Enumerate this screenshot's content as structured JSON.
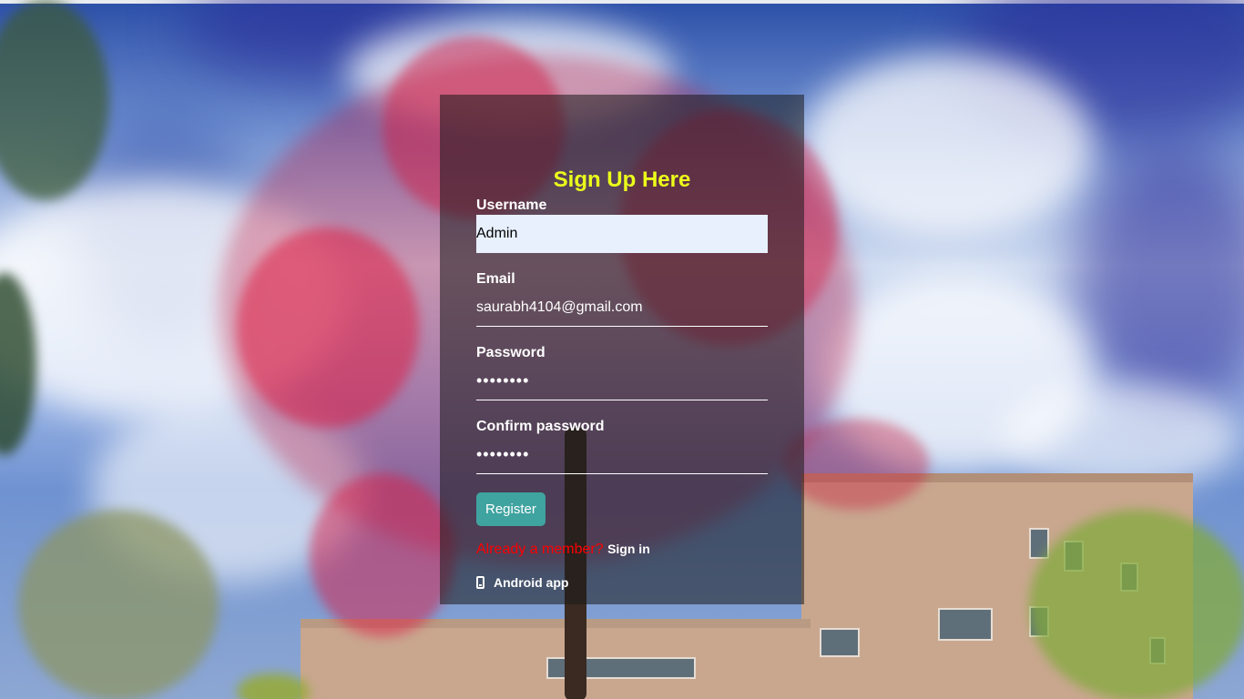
{
  "form": {
    "title": "Sign Up Here",
    "username": {
      "label": "Username",
      "value": "Admin"
    },
    "email": {
      "label": "Email",
      "value": "saurabh4104@gmail.com"
    },
    "password": {
      "label": "Password",
      "value": "••••••••"
    },
    "confirm_password": {
      "label": "Confirm password",
      "value": "••••••••"
    },
    "register_label": "Register",
    "already_member_text": "Already a member?",
    "sign_in_label": "Sign in",
    "android_app_label": "Android app"
  },
  "colors": {
    "title": "#ecff1a",
    "register_button": "#3fa3a0",
    "already_member": "#ff0000",
    "panel_overlay": "rgba(25,25,25,0.55)"
  },
  "icons": {
    "android": "mobile-phone-icon"
  }
}
